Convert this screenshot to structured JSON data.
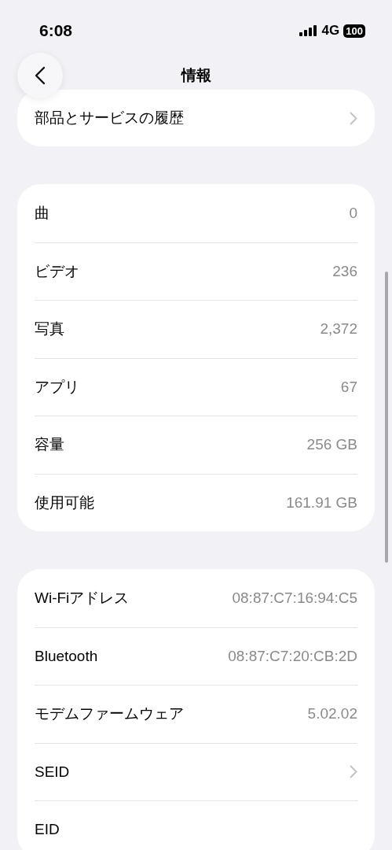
{
  "status_bar": {
    "time": "6:08",
    "network": "4G",
    "battery": "100"
  },
  "nav": {
    "title": "情報"
  },
  "sections": [
    {
      "rows": [
        {
          "label": "部品とサービスの履歴",
          "kind": "link"
        }
      ]
    },
    {
      "rows": [
        {
          "label": "曲",
          "value": "0",
          "kind": "value"
        },
        {
          "label": "ビデオ",
          "value": "236",
          "kind": "value"
        },
        {
          "label": "写真",
          "value": "2,372",
          "kind": "value"
        },
        {
          "label": "アプリ",
          "value": "67",
          "kind": "value"
        },
        {
          "label": "容量",
          "value": "256 GB",
          "kind": "value"
        },
        {
          "label": "使用可能",
          "value": "161.91 GB",
          "kind": "value"
        }
      ]
    },
    {
      "rows": [
        {
          "label": "Wi-Fiアドレス",
          "value": "08:87:C7:16:94:C5",
          "kind": "value"
        },
        {
          "label": "Bluetooth",
          "value": "08:87:C7:20:CB:2D",
          "kind": "value"
        },
        {
          "label": "モデムファームウェア",
          "value": "5.02.02",
          "kind": "value"
        },
        {
          "label": "SEID",
          "kind": "link"
        },
        {
          "label": "EID",
          "kind": "value"
        }
      ]
    }
  ]
}
